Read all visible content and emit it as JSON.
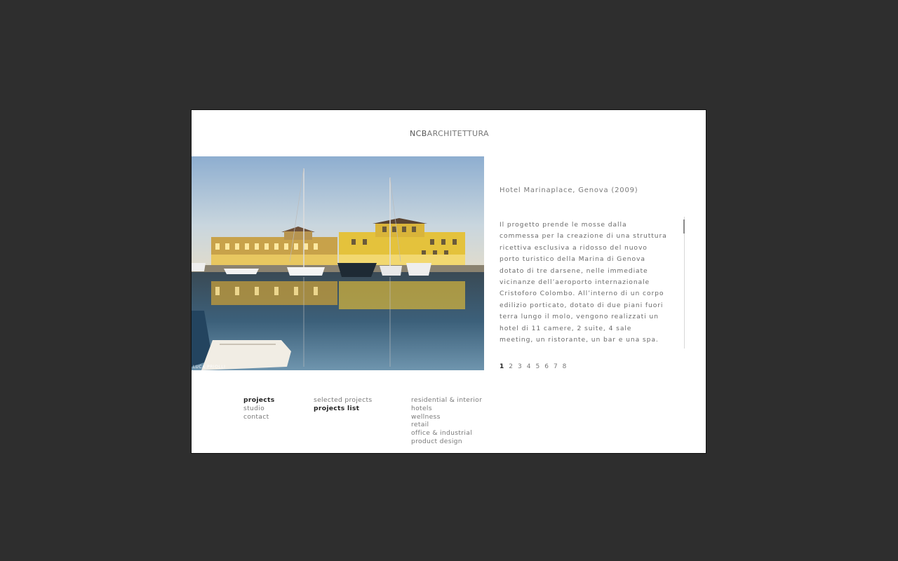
{
  "header": {
    "logo_bold": "NCB",
    "logo_rest": "ARCHITETTURA"
  },
  "photo": {
    "credit": "LUCA PRIOLLI"
  },
  "project": {
    "title": "Hotel Marinaplace, Genova (2009)",
    "description": "Il progetto prende le mosse dalla commessa per la creazione di una struttura ricettiva esclusiva a ridosso del nuovo porto turistico della Marina di Genova dotato di tre darsene, nelle immediate vicinanze dell’aeroporto internazionale Cristoforo Colombo. All’interno di un corpo edilizio porticato, dotato di due piani fuori terra lungo il molo, vengono realizzati un hotel di 11 camere, 2 suite, 4 sale meeting, un ristorante, un bar e una spa."
  },
  "pager": {
    "pages": [
      "1",
      "2",
      "3",
      "4",
      "5",
      "6",
      "7",
      "8"
    ],
    "active_index": 0
  },
  "nav": {
    "main": [
      {
        "label": "projects",
        "active": true
      },
      {
        "label": "studio",
        "active": false
      },
      {
        "label": "contact",
        "active": false
      }
    ],
    "sub": [
      {
        "label": "selected projects",
        "active": false
      },
      {
        "label": "projects list",
        "active": true
      }
    ],
    "categories": [
      {
        "label": "residential & interior"
      },
      {
        "label": "hotels"
      },
      {
        "label": "wellness"
      },
      {
        "label": "retail"
      },
      {
        "label": "office & industrial"
      },
      {
        "label": "product design"
      }
    ]
  }
}
